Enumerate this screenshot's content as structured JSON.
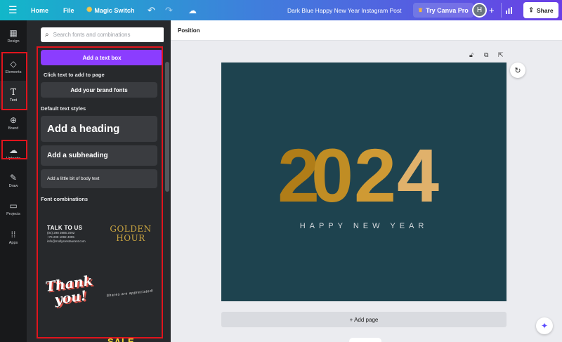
{
  "topbar": {
    "home": "Home",
    "file": "File",
    "magic_switch": "Magic Switch",
    "doc_title": "Dark Blue Happy New Year Instagram Post",
    "try_pro": "Try Canva Pro",
    "avatar_initial": "H",
    "share": "Share"
  },
  "rail": {
    "items": [
      {
        "label": "Design",
        "icon": "design-icon"
      },
      {
        "label": "Elements",
        "icon": "elements-icon"
      },
      {
        "label": "Text",
        "icon": "text-icon"
      },
      {
        "label": "Brand",
        "icon": "brand-icon"
      },
      {
        "label": "Uploads",
        "icon": "upload-icon"
      },
      {
        "label": "Draw",
        "icon": "draw-icon"
      },
      {
        "label": "Projects",
        "icon": "folder-icon"
      },
      {
        "label": "Apps",
        "icon": "apps-icon"
      }
    ],
    "active": "Text"
  },
  "panel": {
    "search_placeholder": "Search fonts and combinations",
    "add_text_box": "Add a text box",
    "click_hint": "Click text to add to page",
    "brand_fonts": "Add your brand fonts",
    "default_styles_label": "Default text styles",
    "heading": "Add a heading",
    "subheading": "Add a subheading",
    "body": "Add a little bit of body text",
    "font_combinations_label": "Font combinations",
    "combos": {
      "talk_title": "TALK TO US",
      "talk_line1": "(04) 298 3985 2092",
      "talk_line2": "+76 209 1092 4095",
      "talk_line3": "info@mollysrestaurant.com",
      "golden_1": "GOLDEN",
      "golden_2": "HOUR",
      "thank_1": "Thank",
      "thank_2": "you!",
      "shares": "Shares are appreciated!",
      "partial": "SALE"
    }
  },
  "editor": {
    "position_label": "Position",
    "year_digits": [
      "2",
      "0",
      "2",
      "4"
    ],
    "greeting": "HAPPY NEW YEAR",
    "add_page": "+ Add page"
  },
  "colors": {
    "accent_purple": "#8b3dff",
    "canvas_bg": "#1e434f",
    "highlight_red": "#e1141d"
  }
}
